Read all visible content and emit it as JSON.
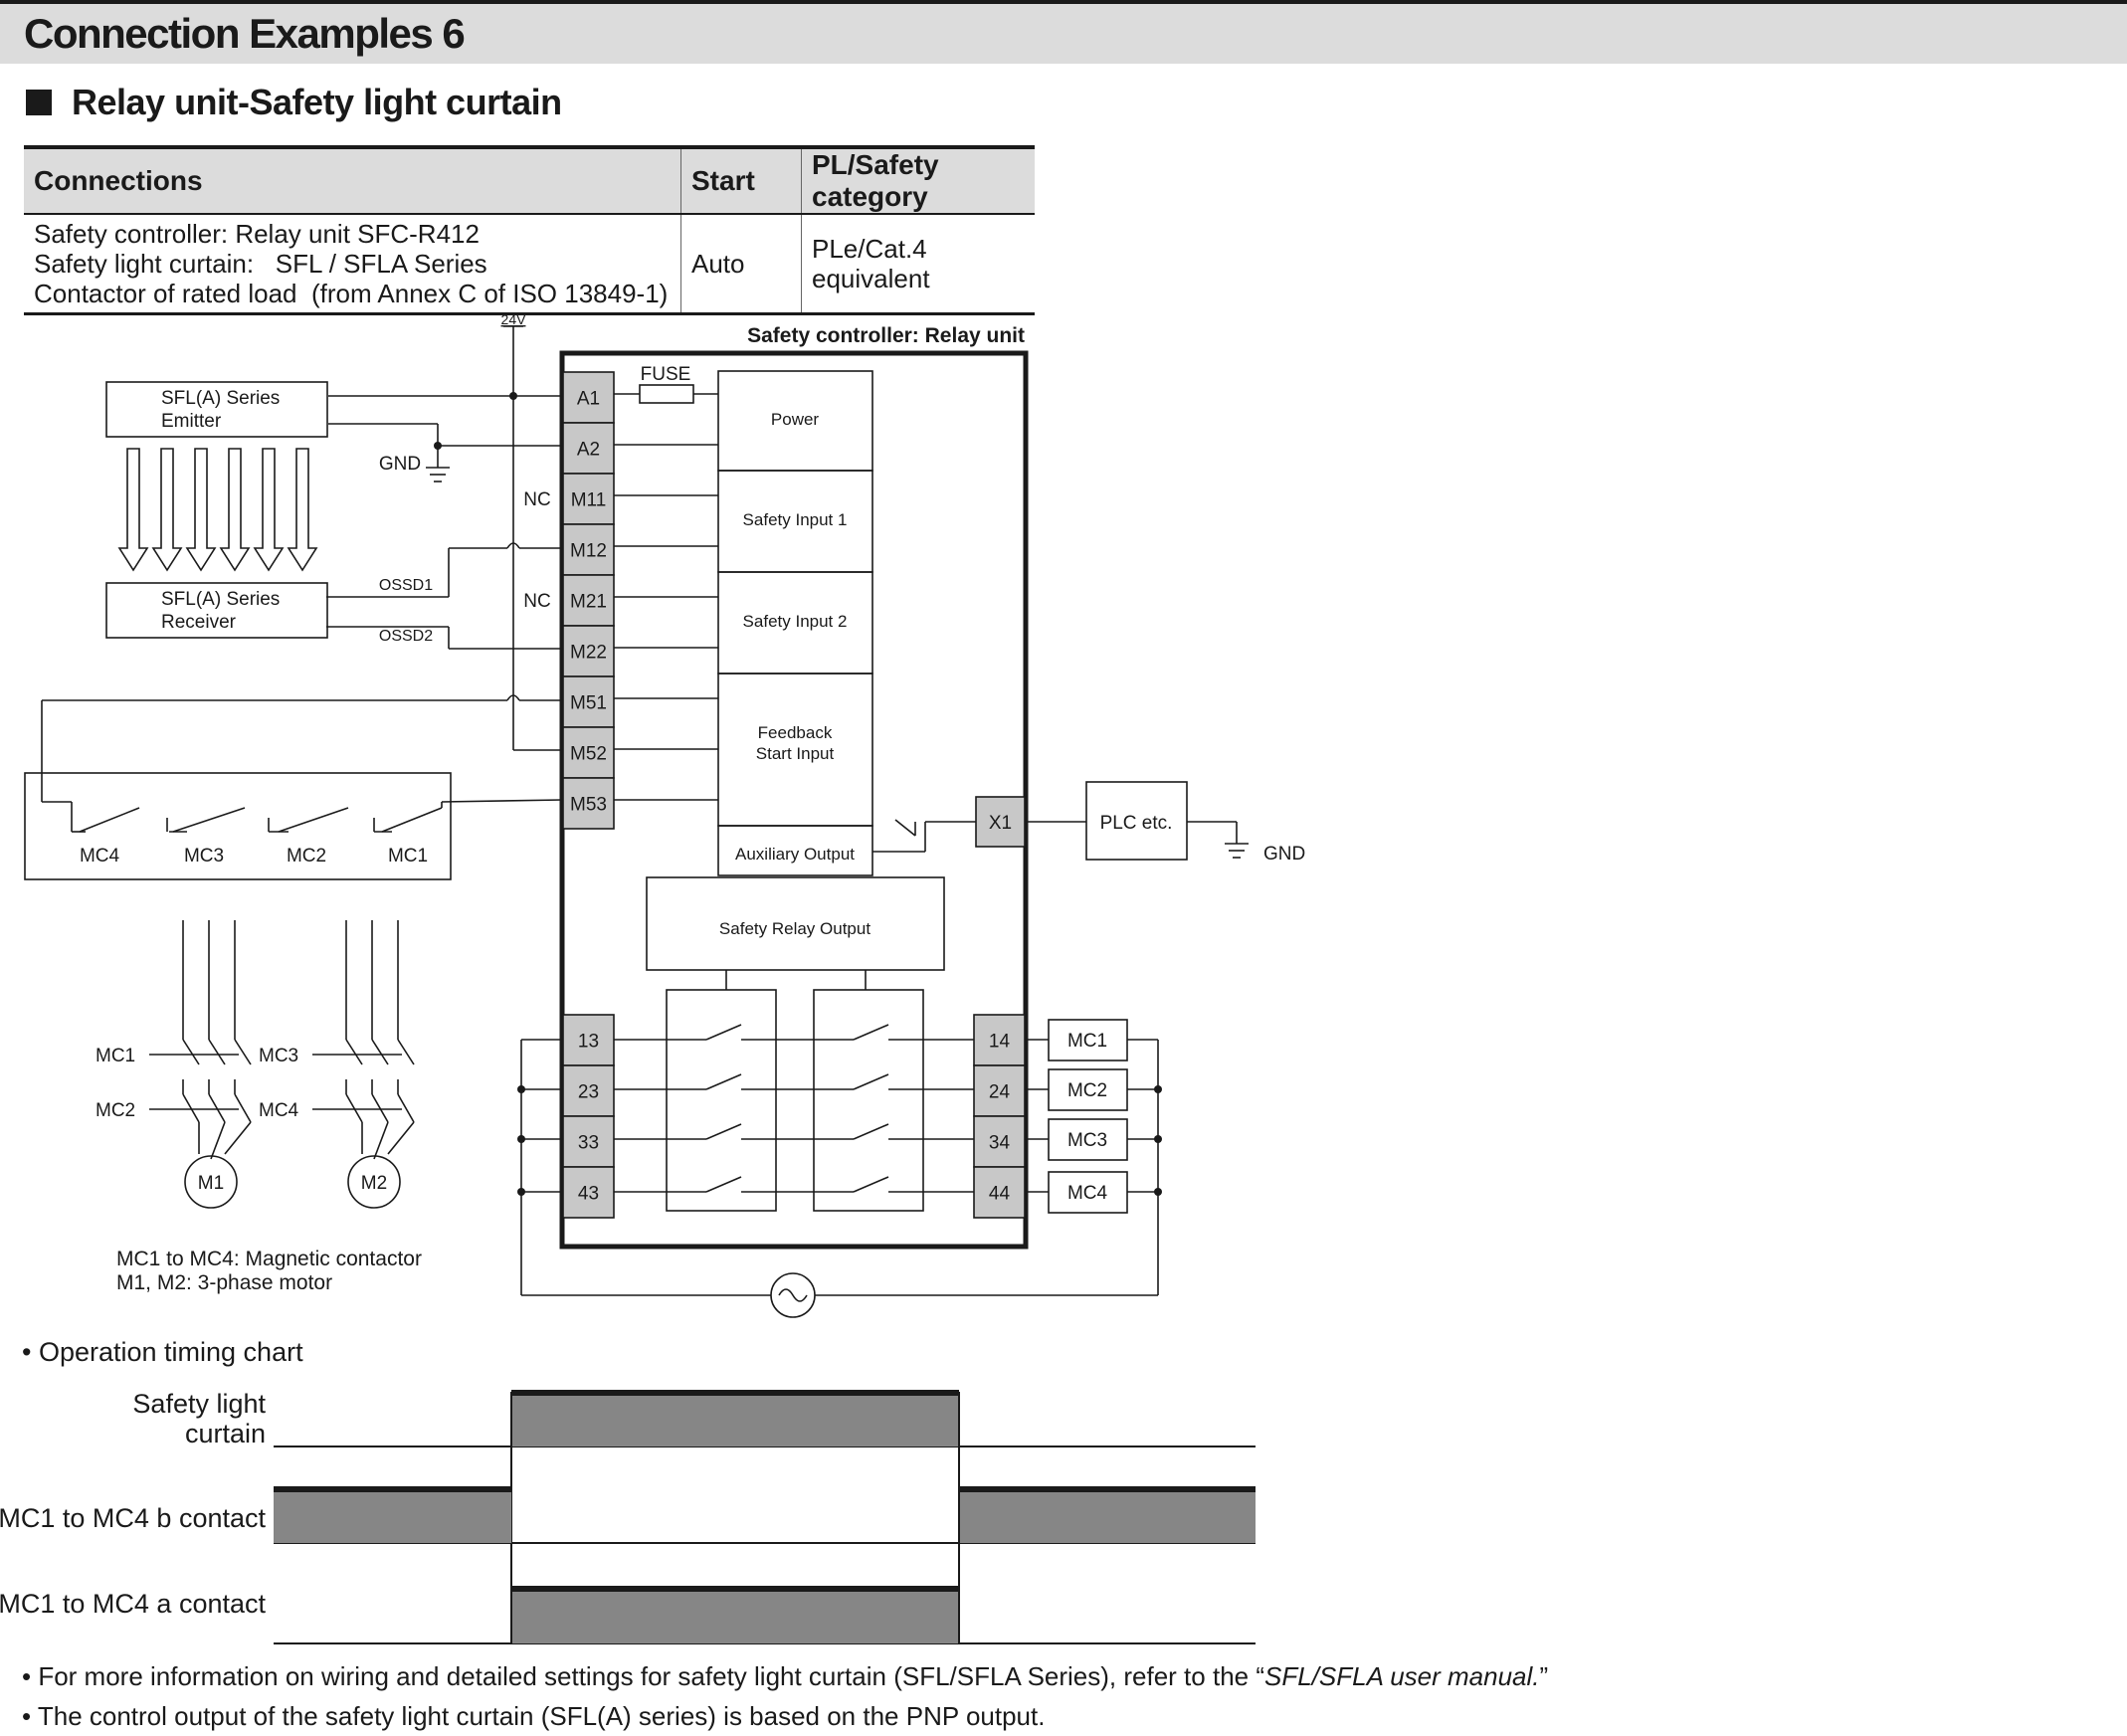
{
  "header": {
    "title": "Connection Examples 6"
  },
  "section": {
    "title": "Relay unit-Safety light curtain"
  },
  "table": {
    "headers": [
      "Connections",
      "Start",
      "PL/Safety category"
    ],
    "rows": [
      {
        "connections": [
          "Safety controller: Relay unit SFC-R412",
          "Safety light curtain:   SFL / SFLA Series",
          "Contactor of rated load  (from Annex C of ISO 13849-1)"
        ],
        "start": "Auto",
        "category": "PLe/Cat.4 equivalent"
      }
    ]
  },
  "diagram": {
    "title": "Safety controller: Relay unit",
    "supply": "24V",
    "gnd": "GND",
    "fuse": "FUSE",
    "nc": "NC",
    "emitter": [
      "SFL(A) Series",
      "Emitter"
    ],
    "receiver": [
      "SFL(A) Series",
      "Receiver"
    ],
    "ossd1": "OSSD1",
    "ossd2": "OSSD2",
    "left_terminals": [
      "A1",
      "A2",
      "M11",
      "M12",
      "M21",
      "M22",
      "M51",
      "M52",
      "M53"
    ],
    "blocks": {
      "power": "Power",
      "safety_input_1": "Safety Input 1",
      "safety_input_2": "Safety Input 2",
      "feedback": [
        "Feedback",
        "Start Input"
      ],
      "auxiliary_output": "Auxiliary Output",
      "safety_relay_output": "Safety Relay Output"
    },
    "x1": "X1",
    "plc": "PLC etc.",
    "feedback_contacts": [
      "MC4",
      "MC3",
      "MC2",
      "MC1"
    ],
    "relay_in_terminals": [
      "13",
      "23",
      "33",
      "43"
    ],
    "relay_out_terminals": [
      "14",
      "24",
      "34",
      "44"
    ],
    "loads": [
      "MC1",
      "MC2",
      "MC3",
      "MC4"
    ],
    "motor_contactors": [
      "MC1",
      "MC2",
      "MC3",
      "MC4"
    ],
    "motors": [
      "M1",
      "M2"
    ],
    "legend": [
      "MC1 to MC4: Magnetic contactor",
      "M1, M2: 3-phase motor"
    ]
  },
  "timing": {
    "title": "• Operation timing chart",
    "rows": [
      "Safety light\ncurtain",
      "MC1 to MC4 b contact",
      "MC1 to MC4 a contact"
    ]
  },
  "notes": [
    "• For more information on wiring and detailed settings for safety light curtain (SFL/SFLA Series), refer to the “",
    "SFL/SFLA user manual.",
    "”",
    "• The control output of the safety light curtain (SFL(A) series) is based on the PNP output."
  ]
}
